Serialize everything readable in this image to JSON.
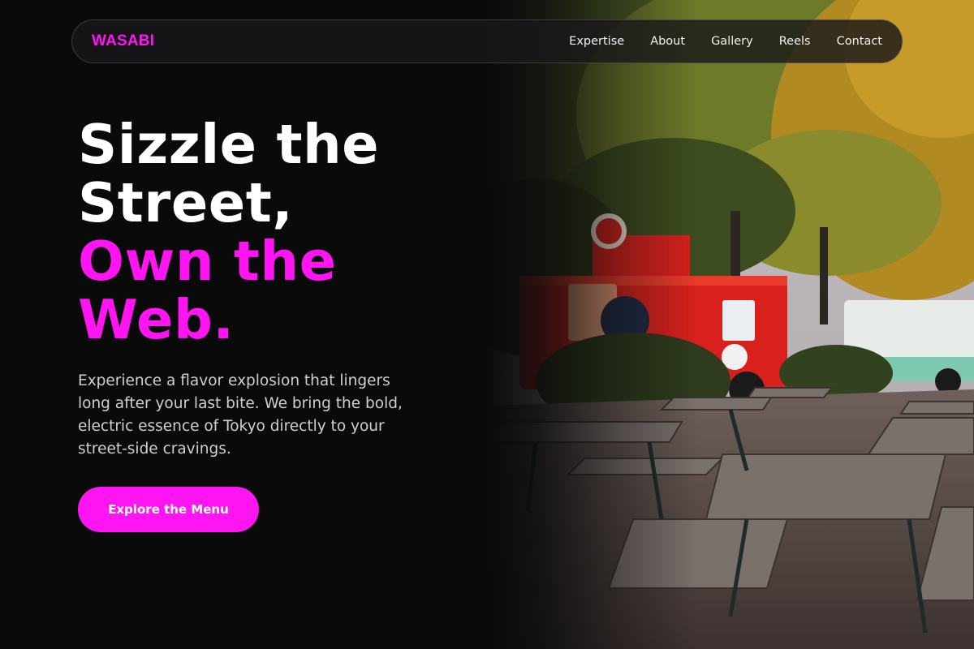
{
  "nav": {
    "brand": "WASABI",
    "links": [
      "Expertise",
      "About",
      "Gallery",
      "Reels",
      "Contact"
    ]
  },
  "hero": {
    "headline_line1": "Sizzle the",
    "headline_line2": "Street,",
    "headline_accent_line1": "Own the",
    "headline_accent_line2": "Web.",
    "description": "Experience a flavor explosion that lingers long after your last bite. We bring the bold, electric essence of Tokyo directly to your street-side cravings.",
    "cta_label": "Explore the Menu",
    "image_subject": "food-truck-park-photo"
  },
  "colors": {
    "background": "#0a0a0b",
    "accent": "#ff14f2",
    "text_primary": "#ffffff",
    "text_secondary": "#cfcfd2"
  }
}
